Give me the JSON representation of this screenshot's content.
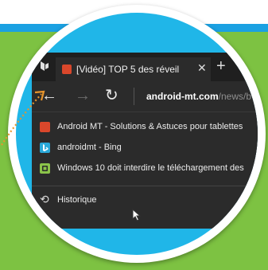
{
  "browser": {
    "tab": {
      "title": "[Vidéo] TOP 5 des réveil",
      "close_glyph": "✕",
      "favicon": "android-mt-favicon"
    },
    "new_tab_glyph": "+",
    "nav": {
      "back_glyph": "←",
      "forward_glyph": "→",
      "refresh_glyph": "↻"
    },
    "address": {
      "host": "android-mt.com",
      "path": "/news/b"
    },
    "suggestions": [
      {
        "icon": "android-mt-favicon",
        "label": "Android MT - Solutions & Astuces pour tablettes",
        "color": "#d9472b"
      },
      {
        "icon": "bing-icon",
        "label": "androidmt - Bing",
        "color": "#2aa8d8"
      },
      {
        "icon": "windows-news-icon",
        "label": "Windows 10 doit interdire le téléchargement des",
        "color": "#8bc34a"
      }
    ],
    "history_label": "Historique",
    "history_glyph": "⟲"
  },
  "colors": {
    "background_green": "#7dc242",
    "accent_blue": "#1ba1e2",
    "browser_dark": "#2b2b2b",
    "arrow_orange": "#e8952c"
  }
}
